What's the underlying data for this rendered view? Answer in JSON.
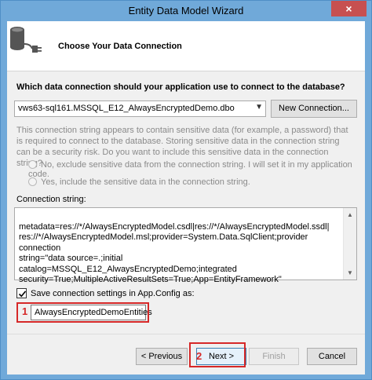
{
  "window": {
    "title": "Entity Data Model Wizard",
    "close_label": "×"
  },
  "header": {
    "title": "Choose Your Data Connection"
  },
  "main": {
    "question": "Which data connection should your application use to connect to the database?",
    "connection_value": "vws63-sql161.MSSQL_E12_AlwaysEncryptedDemo.dbo",
    "new_connection_label": "New Connection...",
    "sensitive_warning": "This connection string appears to contain sensitive data (for example, a password) that is required to connect to the database. Storing sensitive data in the connection string can be a security risk. Do you want to include this sensitive data in the connection string?",
    "option_exclude": "No, exclude sensitive data from the connection string. I will set it in my application code.",
    "option_include": "Yes, include the sensitive data in the connection string.",
    "connection_string_label": "Connection string:",
    "connection_string": "metadata=res://*/AlwaysEncryptedModel.csdl|res://*/AlwaysEncryptedModel.ssdl|\nres://*/AlwaysEncryptedModel.msl;provider=System.Data.SqlClient;provider connection\nstring=\"data source=.;initial catalog=MSSQL_E12_AlwaysEncryptedDemo;integrated\nsecurity=True;MultipleActiveResultSets=True;App=EntityFramework\"",
    "save_checked": true,
    "save_label": "Save connection settings in App.Config as:",
    "entity_name": "AlwaysEncryptedDemoEntities"
  },
  "callouts": {
    "one": "1",
    "two": "2"
  },
  "footer": {
    "previous_label": "< Previous",
    "next_label": "Next >",
    "finish_label": "Finish",
    "cancel_label": "Cancel"
  },
  "colors": {
    "title_bar": "#70a9d9",
    "close_button": "#c75050",
    "callout": "#d62828"
  }
}
